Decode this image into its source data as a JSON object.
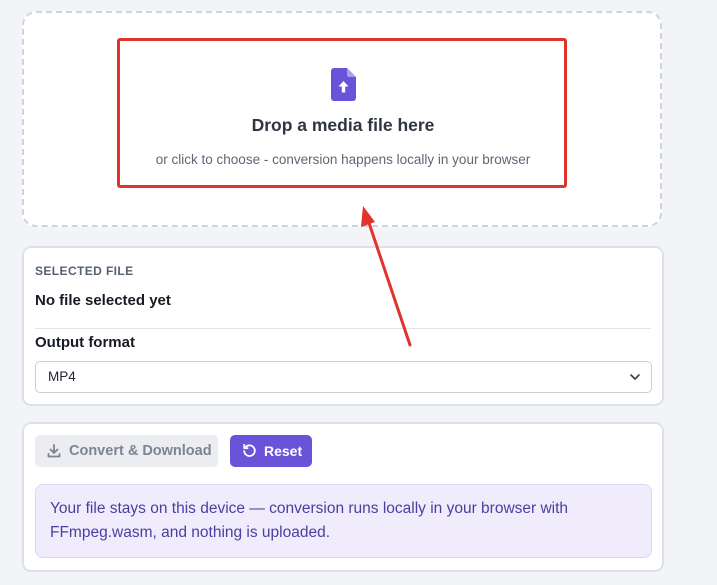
{
  "dropzone": {
    "title": "Drop a media file here",
    "subtitle": "or click to choose - conversion happens locally in your browser",
    "icon": "file-upload-icon",
    "highlight_color": "#e0332d"
  },
  "file_panel": {
    "section_label": "SELECTED FILE",
    "file_status": "No file selected yet",
    "format_label": "Output format",
    "format_value": "MP4",
    "format_options": [
      "MP4"
    ]
  },
  "actions": {
    "convert_label": "Convert & Download",
    "convert_icon": "download-icon",
    "reset_label": "Reset",
    "reset_icon": "reset-icon",
    "accent": "#6a52d9"
  },
  "notice": {
    "text": "Your file stays on this device — conversion runs locally in your browser with FFmpeg.wasm, and nothing is uploaded."
  }
}
